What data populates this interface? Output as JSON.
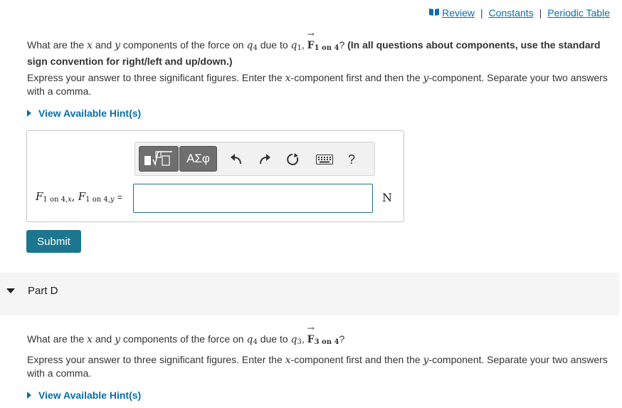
{
  "header": {
    "links": {
      "review": "Review",
      "constants": "Constants",
      "periodic_table": "Periodic Table",
      "separator": "|"
    },
    "book_icon": "book-icon"
  },
  "partC": {
    "question": {
      "t1": "What are the",
      "x": "x",
      "t2": "and",
      "y": "y",
      "t3": "components of the force on",
      "q": "q",
      "q_sub": "4",
      "t4": "due to",
      "q1": "q",
      "q1_sub": "1",
      "comma": ",",
      "F": "F",
      "F_sub": "1 on 4",
      "qmark": "?",
      "bold_note": "(In all questions about components, use the standard sign convention for right/left and up/down.)"
    },
    "instruction": {
      "t1": "Express your answer to three significant figures. Enter the",
      "x": "x",
      "t2": "-component first and then the",
      "y": "y",
      "t3": "-component. Separate your two answers with a comma."
    },
    "hint_label": "View Available Hint(s)",
    "answer": {
      "label_F1": "F",
      "label_sub1": "1 on 4,",
      "label_subx": "x",
      "label_comma": ",",
      "label_F2": "F",
      "label_sub2": "1 on 4,",
      "label_suby": "y",
      "label_eq": "=",
      "input_value": "",
      "unit": "N"
    },
    "toolbar": {
      "greek_label": "ΑΣφ",
      "help_label": "?"
    },
    "submit_label": "Submit"
  },
  "partD": {
    "title": "Part D",
    "question": {
      "t1": "What are the",
      "x": "x",
      "t2": "and",
      "y": "y",
      "t3": "components of the force on",
      "q": "q",
      "q_sub": "4",
      "t4": "due to",
      "q3": "q",
      "q3_sub": "3",
      "comma": ",",
      "F": "F",
      "F_sub": "3 on 4",
      "qmark": "?"
    },
    "instruction": {
      "t1": "Express your answer to three significant figures. Enter the",
      "x": "x",
      "t2": "-component first and then the",
      "y": "y",
      "t3": "-component. Separate your two answers with a comma."
    },
    "hint_label": "View Available Hint(s)"
  },
  "colors": {
    "link": "#0a6ea8",
    "submit_bg": "#1c7690",
    "input_border": "#1f6e8f",
    "toolbar_button": "#6f6f6f",
    "part_bar_bg": "#f5f5f5"
  }
}
